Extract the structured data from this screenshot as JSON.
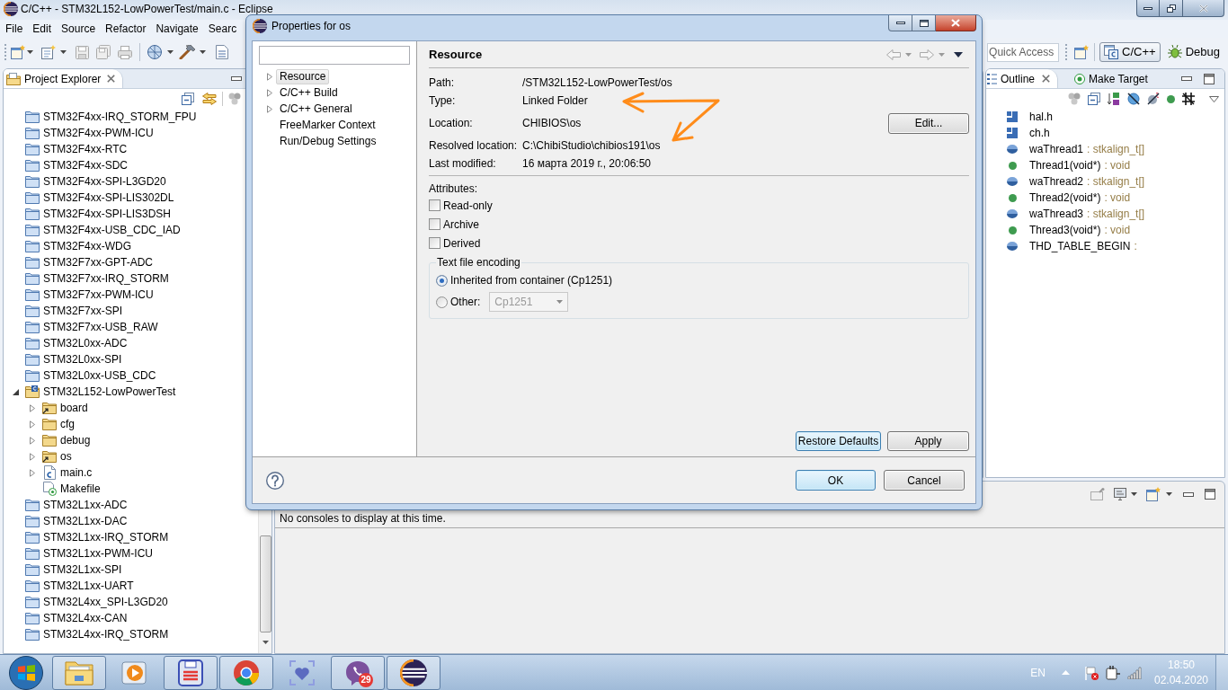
{
  "window": {
    "title": "C/C++ - STM32L152-LowPowerTest/main.c - Eclipse"
  },
  "menu": [
    "File",
    "Edit",
    "Source",
    "Refactor",
    "Navigate",
    "Searc"
  ],
  "toolbar": {
    "quick_access": {
      "placeholder": "Quick Access"
    },
    "perspectives": [
      {
        "label": "C/C++",
        "kind": "cpp",
        "selected": true
      },
      {
        "label": "Debug",
        "kind": "debug",
        "selected": false
      }
    ]
  },
  "project_explorer": {
    "title": "Project Explorer",
    "items": [
      {
        "label": "STM32F4xx-IRQ_STORM_FPU",
        "kind": "closed_project"
      },
      {
        "label": "STM32F4xx-PWM-ICU",
        "kind": "closed_project"
      },
      {
        "label": "STM32F4xx-RTC",
        "kind": "closed_project"
      },
      {
        "label": "STM32F4xx-SDC",
        "kind": "closed_project"
      },
      {
        "label": "STM32F4xx-SPI-L3GD20",
        "kind": "closed_project"
      },
      {
        "label": "STM32F4xx-SPI-LIS302DL",
        "kind": "closed_project"
      },
      {
        "label": "STM32F4xx-SPI-LIS3DSH",
        "kind": "closed_project"
      },
      {
        "label": "STM32F4xx-USB_CDC_IAD",
        "kind": "closed_project"
      },
      {
        "label": "STM32F4xx-WDG",
        "kind": "closed_project"
      },
      {
        "label": "STM32F7xx-GPT-ADC",
        "kind": "closed_project"
      },
      {
        "label": "STM32F7xx-IRQ_STORM",
        "kind": "closed_project"
      },
      {
        "label": "STM32F7xx-PWM-ICU",
        "kind": "closed_project"
      },
      {
        "label": "STM32F7xx-SPI",
        "kind": "closed_project"
      },
      {
        "label": "STM32F7xx-USB_RAW",
        "kind": "closed_project"
      },
      {
        "label": "STM32L0xx-ADC",
        "kind": "closed_project"
      },
      {
        "label": "STM32L0xx-SPI",
        "kind": "closed_project"
      },
      {
        "label": "STM32L0xx-USB_CDC",
        "kind": "closed_project"
      },
      {
        "label": "STM32L152-LowPowerTest",
        "kind": "project",
        "expanded": true,
        "children": [
          {
            "label": "board",
            "kind": "folder",
            "expanded": false,
            "linked": true
          },
          {
            "label": "cfg",
            "kind": "folder",
            "expanded": false,
            "linked": false
          },
          {
            "label": "debug",
            "kind": "folder",
            "expanded": false,
            "linked": false
          },
          {
            "label": "os",
            "kind": "folder",
            "expanded": false,
            "linked": true
          },
          {
            "label": "main.c",
            "kind": "c_file",
            "expanded": false
          },
          {
            "label": "Makefile",
            "kind": "makefile"
          }
        ]
      },
      {
        "label": "STM32L1xx-ADC",
        "kind": "closed_project"
      },
      {
        "label": "STM32L1xx-DAC",
        "kind": "closed_project"
      },
      {
        "label": "STM32L1xx-IRQ_STORM",
        "kind": "closed_project"
      },
      {
        "label": "STM32L1xx-PWM-ICU",
        "kind": "closed_project"
      },
      {
        "label": "STM32L1xx-SPI",
        "kind": "closed_project"
      },
      {
        "label": "STM32L1xx-UART",
        "kind": "closed_project"
      },
      {
        "label": "STM32L4xx_SPI-L3GD20",
        "kind": "closed_project"
      },
      {
        "label": "STM32L4xx-CAN",
        "kind": "closed_project"
      },
      {
        "label": "STM32L4xx-IRQ_STORM",
        "kind": "closed_project"
      }
    ]
  },
  "outline": {
    "tabs": [
      {
        "label": "Outline",
        "kind": "outline",
        "selected": true
      },
      {
        "label": "Make Target",
        "kind": "make_target",
        "selected": false
      }
    ],
    "items": [
      {
        "kind": "include",
        "name": "hal.h"
      },
      {
        "kind": "include",
        "name": "ch.h"
      },
      {
        "kind": "variable",
        "name": "waThread1",
        "type": ": stkalign_t[]"
      },
      {
        "kind": "function",
        "name": "Thread1(void*)",
        "type": ": void"
      },
      {
        "kind": "variable",
        "name": "waThread2",
        "type": ": stkalign_t[]"
      },
      {
        "kind": "function",
        "name": "Thread2(void*)",
        "type": ": void"
      },
      {
        "kind": "variable",
        "name": "waThread3",
        "type": ": stkalign_t[]"
      },
      {
        "kind": "function",
        "name": "Thread3(void*)",
        "type": ": void"
      },
      {
        "kind": "variable",
        "name": "THD_TABLE_BEGIN",
        "type": ":"
      }
    ]
  },
  "console": {
    "message": "No consoles to display at this time."
  },
  "dialog": {
    "title": "Properties for os",
    "nav": [
      {
        "label": "Resource",
        "selected": true,
        "expanded": false
      },
      {
        "label": "C/C++ Build",
        "selected": false,
        "expanded": false
      },
      {
        "label": "C/C++ General",
        "selected": false,
        "expanded": false
      },
      {
        "label": "FreeMarker Context",
        "selected": false
      },
      {
        "label": "Run/Debug Settings",
        "selected": false
      }
    ],
    "page": {
      "title": "Resource",
      "properties": [
        {
          "label": "Path:",
          "value": "/STM32L152-LowPowerTest/os"
        },
        {
          "label": "Type:",
          "value": "Linked Folder"
        },
        {
          "label": "Location:",
          "value": "CHIBIOS\\os",
          "button": "Edit..."
        },
        {
          "label": "Resolved location:",
          "value": "C:\\ChibiStudio\\chibios191\\os"
        },
        {
          "label": "Last modified:",
          "value": "16 марта 2019 г., 20:06:50"
        }
      ],
      "attributes_label": "Attributes:",
      "attributes": [
        {
          "label": "Read-only",
          "checked": false
        },
        {
          "label": "Archive",
          "checked": false
        },
        {
          "label": "Derived",
          "checked": false
        }
      ],
      "encoding": {
        "title": "Text file encoding",
        "options": [
          {
            "label": "Inherited from container (Cp1251)",
            "selected": true
          },
          {
            "label": "Other:",
            "selected": false,
            "combo": {
              "value": "Cp1251",
              "disabled": true
            }
          }
        ]
      },
      "buttons": [
        {
          "label": "Restore Defaults",
          "focused": true
        },
        {
          "label": "Apply",
          "focused": false
        }
      ]
    },
    "buttons": [
      {
        "label": "OK",
        "default": true
      },
      {
        "label": "Cancel",
        "default": false
      }
    ]
  },
  "taskbar": {
    "apps": [
      {
        "kind": "explorer",
        "running": true
      },
      {
        "kind": "media",
        "running": false
      },
      {
        "kind": "floppy",
        "running": true
      },
      {
        "kind": "browser",
        "running": true
      },
      {
        "kind": "heart",
        "running": false
      },
      {
        "kind": "messenger",
        "running": true,
        "badge": "29"
      },
      {
        "kind": "ide",
        "running": true
      }
    ],
    "language": "EN",
    "time": "18:50",
    "date": "02.04.2020"
  }
}
